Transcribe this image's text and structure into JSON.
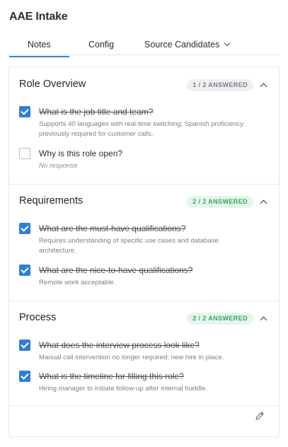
{
  "app": {
    "title": "AAE Intake"
  },
  "tabs": [
    {
      "label": "Notes",
      "active": true
    },
    {
      "label": "Config",
      "active": false
    },
    {
      "label": "Source Candidates",
      "active": false
    }
  ],
  "sections": [
    {
      "title": "Role Overview",
      "badge": "1 / 2 ANSWERED",
      "questions": [
        {
          "text": "What is the job title and team?",
          "answered": true,
          "answer": "Supports 40 languages with real-time switching; Spanish proficiency previously required for customer calls."
        },
        {
          "text": "Why is this role open?",
          "answered": false,
          "answer": "No response"
        }
      ]
    },
    {
      "title": "Requirements",
      "badge": "2 / 2 ANSWERED",
      "questions": [
        {
          "text": "What are the must-have qualifications?",
          "answered": true,
          "answer": "Requires understanding of specific use cases and database architecture."
        },
        {
          "text": "What are the nice-to-have qualifications?",
          "answered": true,
          "answer": "Remote work acceptable."
        }
      ]
    },
    {
      "title": "Process",
      "badge": "2 / 2 ANSWERED",
      "questions": [
        {
          "text": "What does the interview process look like?",
          "answered": true,
          "answer": "Manual call intervention no longer required; new hire in place."
        },
        {
          "text": "What is the timeline for filling this role?",
          "answered": true,
          "answer": "Hiring manager to initiate follow-up after internal huddle."
        }
      ]
    }
  ],
  "icons": {
    "edit": "pencil-icon",
    "collapse": "chevron-up-icon",
    "dropdown": "chevron-down-icon",
    "checkbox": "check-icon"
  },
  "colors": {
    "accent": "#2f7fd4",
    "complete_badge": "#3aa463",
    "partial_badge": "#7a8088"
  }
}
